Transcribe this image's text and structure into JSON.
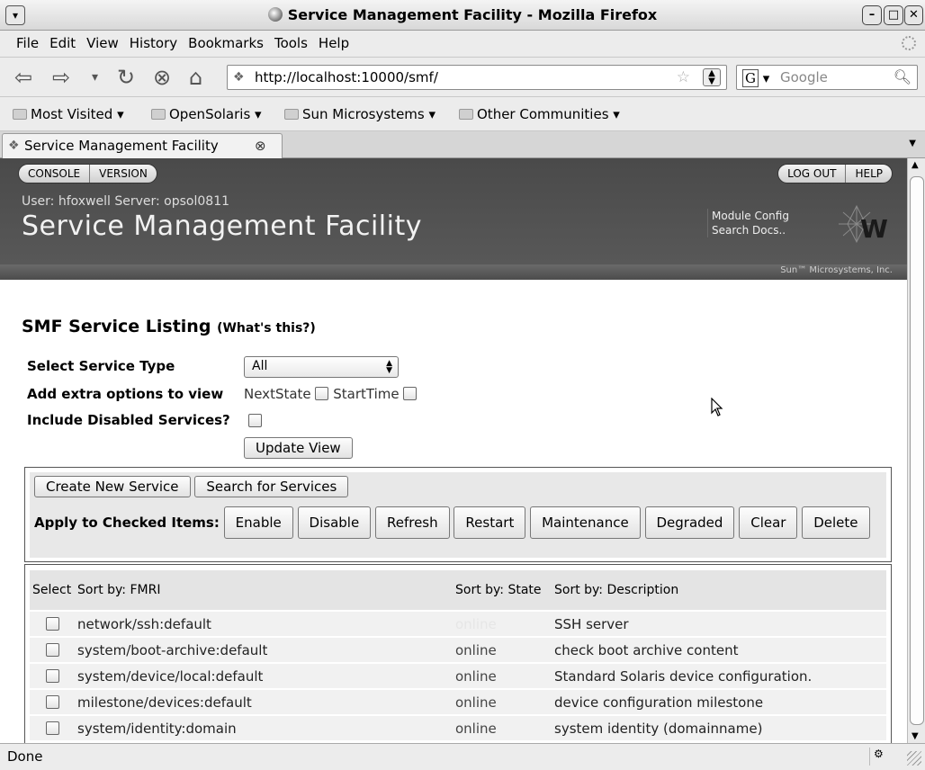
{
  "window": {
    "title": "Service Management Facility - Mozilla Firefox",
    "menu_glyph": "▾",
    "minimize": "–",
    "maximize": "□",
    "close": "✕"
  },
  "menubar": {
    "items": [
      "File",
      "Edit",
      "View",
      "History",
      "Bookmarks",
      "Tools",
      "Help"
    ]
  },
  "navbar": {
    "back": "⇦",
    "forward": "⇨",
    "history_drop": "▾",
    "reload": "↻",
    "stop": "⊗",
    "home": "⌂",
    "url": "http://localhost:10000/smf/",
    "search_engine": "G",
    "search_placeholder": "Google"
  },
  "bookmarks": {
    "items": [
      "Most Visited ▾",
      "OpenSolaris ▾",
      "Sun Microsystems ▾",
      "Other Communities ▾"
    ]
  },
  "tabs": {
    "active_label": "Service Management Facility",
    "close": "⊗"
  },
  "header": {
    "left_buttons": [
      "CONSOLE",
      "VERSION"
    ],
    "right_buttons": [
      "LOG OUT",
      "HELP"
    ],
    "user_line": "User: hfoxwell   Server: opsol0811",
    "app_title": "Service Management Facility",
    "module_config": "Module Config",
    "search_docs": "Search Docs..",
    "logo_letter": "W",
    "sun_mark": "Sun™ Microsystems, Inc."
  },
  "page": {
    "title": "SMF Service Listing",
    "help_link": "(What's this?)",
    "select_type_label": "Select Service Type",
    "select_type_value": "All",
    "extra_options_label": "Add extra options to view",
    "opt_nextstate": "NextState",
    "opt_starttime": "StartTime",
    "include_disabled_label": "Include Disabled Services?",
    "update_view": "Update View"
  },
  "actions": {
    "create": "Create New Service",
    "search": "Search for Services",
    "apply_label": "Apply to Checked Items",
    "buttons": [
      "Enable",
      "Disable",
      "Refresh",
      "Restart",
      "Maintenance",
      "Degraded",
      "Clear",
      "Delete"
    ]
  },
  "table": {
    "headers": [
      "Select",
      "Sort by: FMRI",
      "Sort by: State",
      "Sort by: Description"
    ],
    "rows": [
      {
        "fmri": "network/ssh:default",
        "state": "online",
        "desc": "SSH server",
        "state_faded": true
      },
      {
        "fmri": "system/boot-archive:default",
        "state": "online",
        "desc": "check boot archive content",
        "state_faded": false
      },
      {
        "fmri": "system/device/local:default",
        "state": "online",
        "desc": "Standard Solaris device configuration.",
        "state_faded": false
      },
      {
        "fmri": "milestone/devices:default",
        "state": "online",
        "desc": "device configuration milestone",
        "state_faded": false
      },
      {
        "fmri": "system/identity:domain",
        "state": "online",
        "desc": "system identity (domainname)",
        "state_faded": false
      }
    ]
  },
  "status": {
    "text": "Done"
  }
}
